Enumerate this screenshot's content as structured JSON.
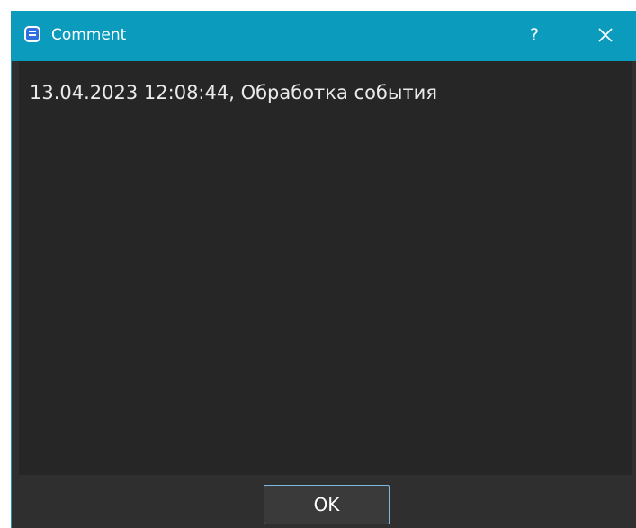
{
  "window": {
    "title": "Comment",
    "help_label": "?",
    "icon": "comment-app-icon",
    "close_icon": "close-icon"
  },
  "content": {
    "comment_text": "13.04.2023 12:08:44, Обработка события"
  },
  "buttons": {
    "ok_label": "OK"
  },
  "colors": {
    "titlebar": "#0a9bbd",
    "background": "#2f2f2f",
    "text_area": "#262626",
    "button_border": "#7eb8e0"
  }
}
